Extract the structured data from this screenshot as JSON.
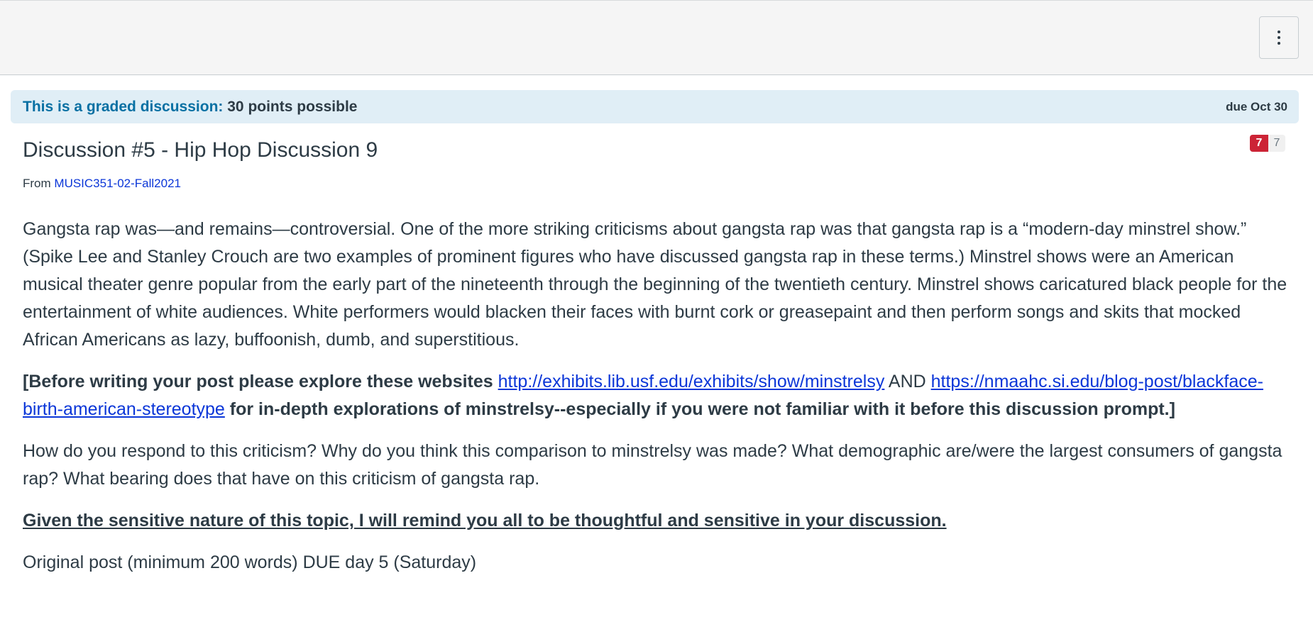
{
  "toolbar": {
    "menu_icon": "kebab-vertical-icon"
  },
  "graded": {
    "label": "This is a graded discussion:",
    "points": "30 points possible",
    "due": "due Oct 30"
  },
  "discussion": {
    "title": "Discussion #5 - Hip Hop Discussion 9",
    "from_label": "From",
    "course_link": "MUSIC351-02-Fall2021",
    "unread_count": "7",
    "total_count": "7"
  },
  "body": {
    "p1": "Gangsta rap was—and remains—controversial. One of the more striking criticisms about gangsta rap was that gangsta rap is a “modern-day minstrel show.” (Spike Lee and Stanley Crouch are two examples of prominent figures who have discussed gangsta rap in these terms.) Minstrel shows were an American musical theater genre popular from the early part of the nineteenth through the beginning of the twentieth century. Minstrel shows caricatured black people for the entertainment of white audiences. White performers would blacken their faces with burnt cork or greasepaint and then perform songs and skits that mocked African Americans as lazy, buffoonish, dumb, and superstitious.",
    "p2_prefix": "[Before writing your post please explore these websites ",
    "link1": "http://exhibits.lib.usf.edu/exhibits/show/minstrelsy",
    "p2_and": " AND ",
    "link2": "https://nmaahc.si.edu/blog-post/blackface-birth-american-stereotype",
    "p2_suffix": " for in-depth explorations of minstrelsy--especially if you were not familiar with it before this discussion prompt.]",
    "p3": "How do you respond to this criticism? Why do you think this comparison to minstrelsy was made? What demographic are/were the largest consumers of gangsta rap? What bearing does that have on this criticism of gangsta rap.",
    "p4": "Given the sensitive nature of this topic, I will remind you all to be thoughtful and sensitive in your discussion.",
    "p5": "Original post (minimum 200 words) DUE day 5 (Saturday)"
  }
}
